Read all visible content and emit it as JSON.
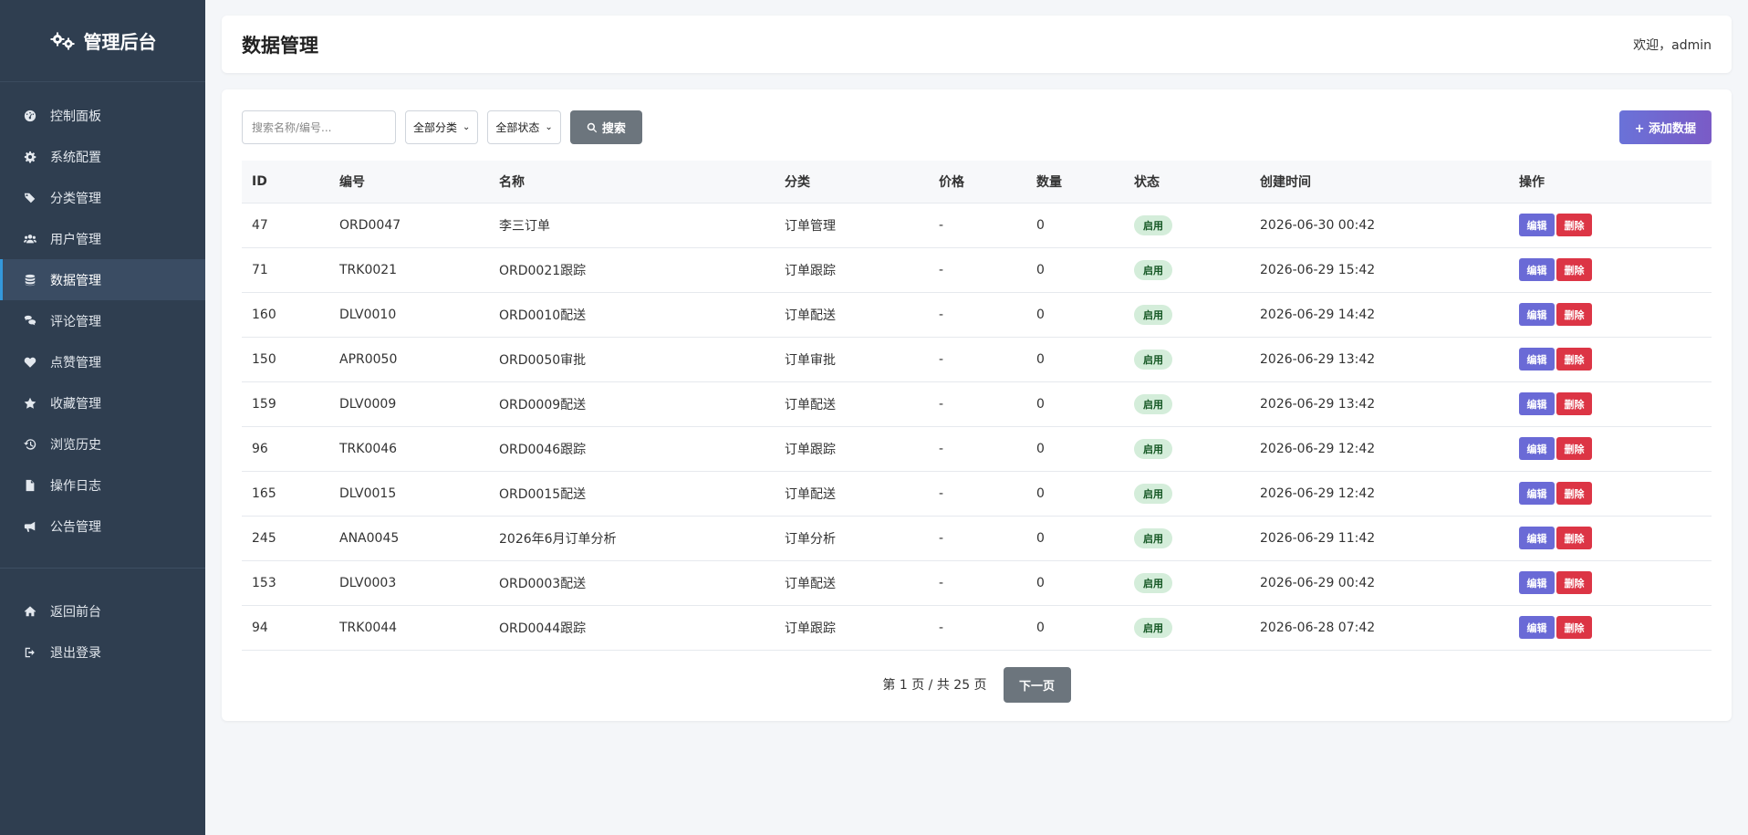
{
  "brand": {
    "title": "管理后台",
    "icon": "gears-icon"
  },
  "sidebar": {
    "items": [
      {
        "label": "控制面板",
        "icon": "dashboard-icon"
      },
      {
        "label": "系统配置",
        "icon": "gear-icon"
      },
      {
        "label": "分类管理",
        "icon": "tags-icon"
      },
      {
        "label": "用户管理",
        "icon": "users-icon"
      },
      {
        "label": "数据管理",
        "icon": "database-icon",
        "active": true
      },
      {
        "label": "评论管理",
        "icon": "comments-icon"
      },
      {
        "label": "点赞管理",
        "icon": "heart-icon"
      },
      {
        "label": "收藏管理",
        "icon": "star-icon"
      },
      {
        "label": "浏览历史",
        "icon": "history-icon"
      },
      {
        "label": "操作日志",
        "icon": "file-icon"
      },
      {
        "label": "公告管理",
        "icon": "bullhorn-icon"
      }
    ],
    "bottom_items": [
      {
        "label": "返回前台",
        "icon": "home-icon"
      },
      {
        "label": "退出登录",
        "icon": "sign-out-icon"
      }
    ]
  },
  "header": {
    "title": "数据管理",
    "welcome": "欢迎，admin"
  },
  "toolbar": {
    "search_placeholder": "搜索名称/编号...",
    "category_select": "全部分类",
    "status_select": "全部状态",
    "search_label": "搜索",
    "add_label": "+ 添加数据"
  },
  "table": {
    "columns": [
      "ID",
      "编号",
      "名称",
      "分类",
      "价格",
      "数量",
      "状态",
      "创建时间",
      "操作"
    ],
    "edit_label": "编辑",
    "delete_label": "删除",
    "rows": [
      {
        "id": "47",
        "code": "ORD0047",
        "name": "李三订单",
        "category": "订单管理",
        "price": "-",
        "qty": "0",
        "status": "启用",
        "created": "2026-06-30 00:42"
      },
      {
        "id": "71",
        "code": "TRK0021",
        "name": "ORD0021跟踪",
        "category": "订单跟踪",
        "price": "-",
        "qty": "0",
        "status": "启用",
        "created": "2026-06-29 15:42"
      },
      {
        "id": "160",
        "code": "DLV0010",
        "name": "ORD0010配送",
        "category": "订单配送",
        "price": "-",
        "qty": "0",
        "status": "启用",
        "created": "2026-06-29 14:42"
      },
      {
        "id": "150",
        "code": "APR0050",
        "name": "ORD0050审批",
        "category": "订单审批",
        "price": "-",
        "qty": "0",
        "status": "启用",
        "created": "2026-06-29 13:42"
      },
      {
        "id": "159",
        "code": "DLV0009",
        "name": "ORD0009配送",
        "category": "订单配送",
        "price": "-",
        "qty": "0",
        "status": "启用",
        "created": "2026-06-29 13:42"
      },
      {
        "id": "96",
        "code": "TRK0046",
        "name": "ORD0046跟踪",
        "category": "订单跟踪",
        "price": "-",
        "qty": "0",
        "status": "启用",
        "created": "2026-06-29 12:42"
      },
      {
        "id": "165",
        "code": "DLV0015",
        "name": "ORD0015配送",
        "category": "订单配送",
        "price": "-",
        "qty": "0",
        "status": "启用",
        "created": "2026-06-29 12:42"
      },
      {
        "id": "245",
        "code": "ANA0045",
        "name": "2026年6月订单分析",
        "category": "订单分析",
        "price": "-",
        "qty": "0",
        "status": "启用",
        "created": "2026-06-29 11:42"
      },
      {
        "id": "153",
        "code": "DLV0003",
        "name": "ORD0003配送",
        "category": "订单配送",
        "price": "-",
        "qty": "0",
        "status": "启用",
        "created": "2026-06-29 00:42"
      },
      {
        "id": "94",
        "code": "TRK0044",
        "name": "ORD0044跟踪",
        "category": "订单跟踪",
        "price": "-",
        "qty": "0",
        "status": "启用",
        "created": "2026-06-28 07:42"
      }
    ]
  },
  "pagination": {
    "info": "第 1 页 / 共 25 页",
    "next_label": "下一页"
  },
  "colors": {
    "sidebar_bg": "#2f3e50",
    "accent": "#3498db",
    "edit": "#6a6ad6",
    "delete": "#dc3545",
    "badge_bg": "#d4edda"
  }
}
